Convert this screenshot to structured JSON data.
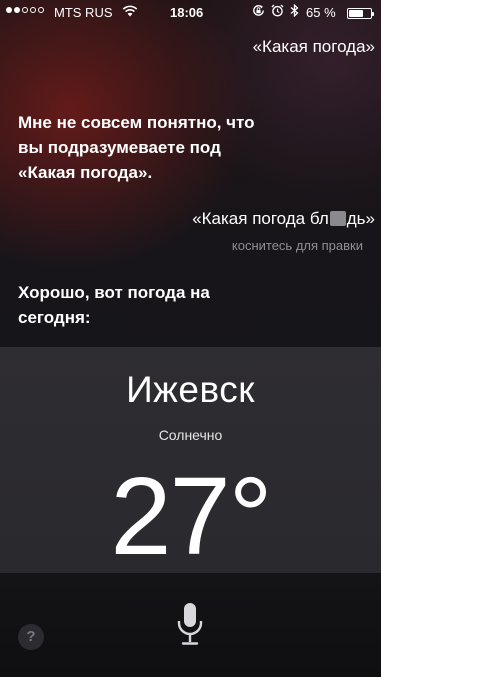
{
  "status_bar": {
    "carrier": "MTS RUS",
    "time": "18:06",
    "battery_percent": "65 %",
    "battery_level": 0.65,
    "signal_bars": 2
  },
  "conversation": {
    "user_query_1": "«Какая погода»",
    "siri_reply_1_line1": "Мне не совсем понятно, что",
    "siri_reply_1_line2": "вы подразумеваете под",
    "siri_reply_1_line3": "«Какая погода».",
    "user_query_2_before": "«Какая погода бл",
    "user_query_2_after": "дь»",
    "tap_to_edit": "коснитесь для правки",
    "siri_reply_2_line1": "Хорошо, вот погода на",
    "siri_reply_2_line2": "сегодня:"
  },
  "weather": {
    "city": "Ижевск",
    "condition": "Солнечно",
    "temperature": "27°"
  },
  "bottom_bar": {
    "help_label": "?"
  }
}
